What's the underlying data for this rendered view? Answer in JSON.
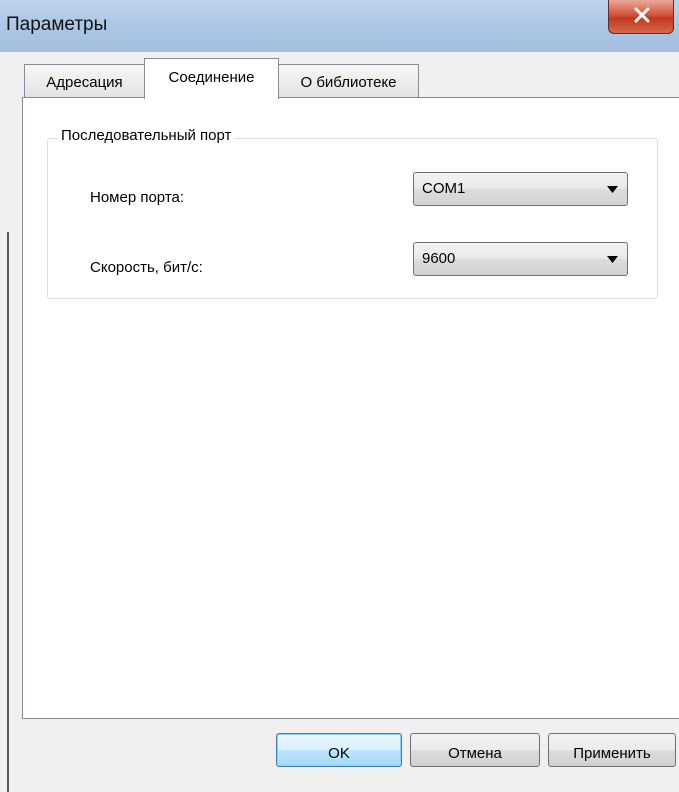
{
  "window": {
    "title": "Параметры"
  },
  "tabs": [
    {
      "label": "Адресация",
      "active": false
    },
    {
      "label": "Соединение",
      "active": true
    },
    {
      "label": "О библиотеке",
      "active": false
    }
  ],
  "serial_port_group": {
    "title": "Последовательный порт",
    "port": {
      "label": "Номер порта:",
      "selected": "COM1"
    },
    "speed": {
      "label": "Скорость, бит/с:",
      "selected": "9600"
    }
  },
  "buttons": {
    "ok": "OK",
    "cancel": "Отмена",
    "apply": "Применить"
  },
  "colors": {
    "titlebar": "#adc7e5",
    "close_button": "#c0391f",
    "default_button_border": "#3c7fb1"
  },
  "icons": {
    "close": "close-icon",
    "dropdown": "chevron-down-icon"
  }
}
